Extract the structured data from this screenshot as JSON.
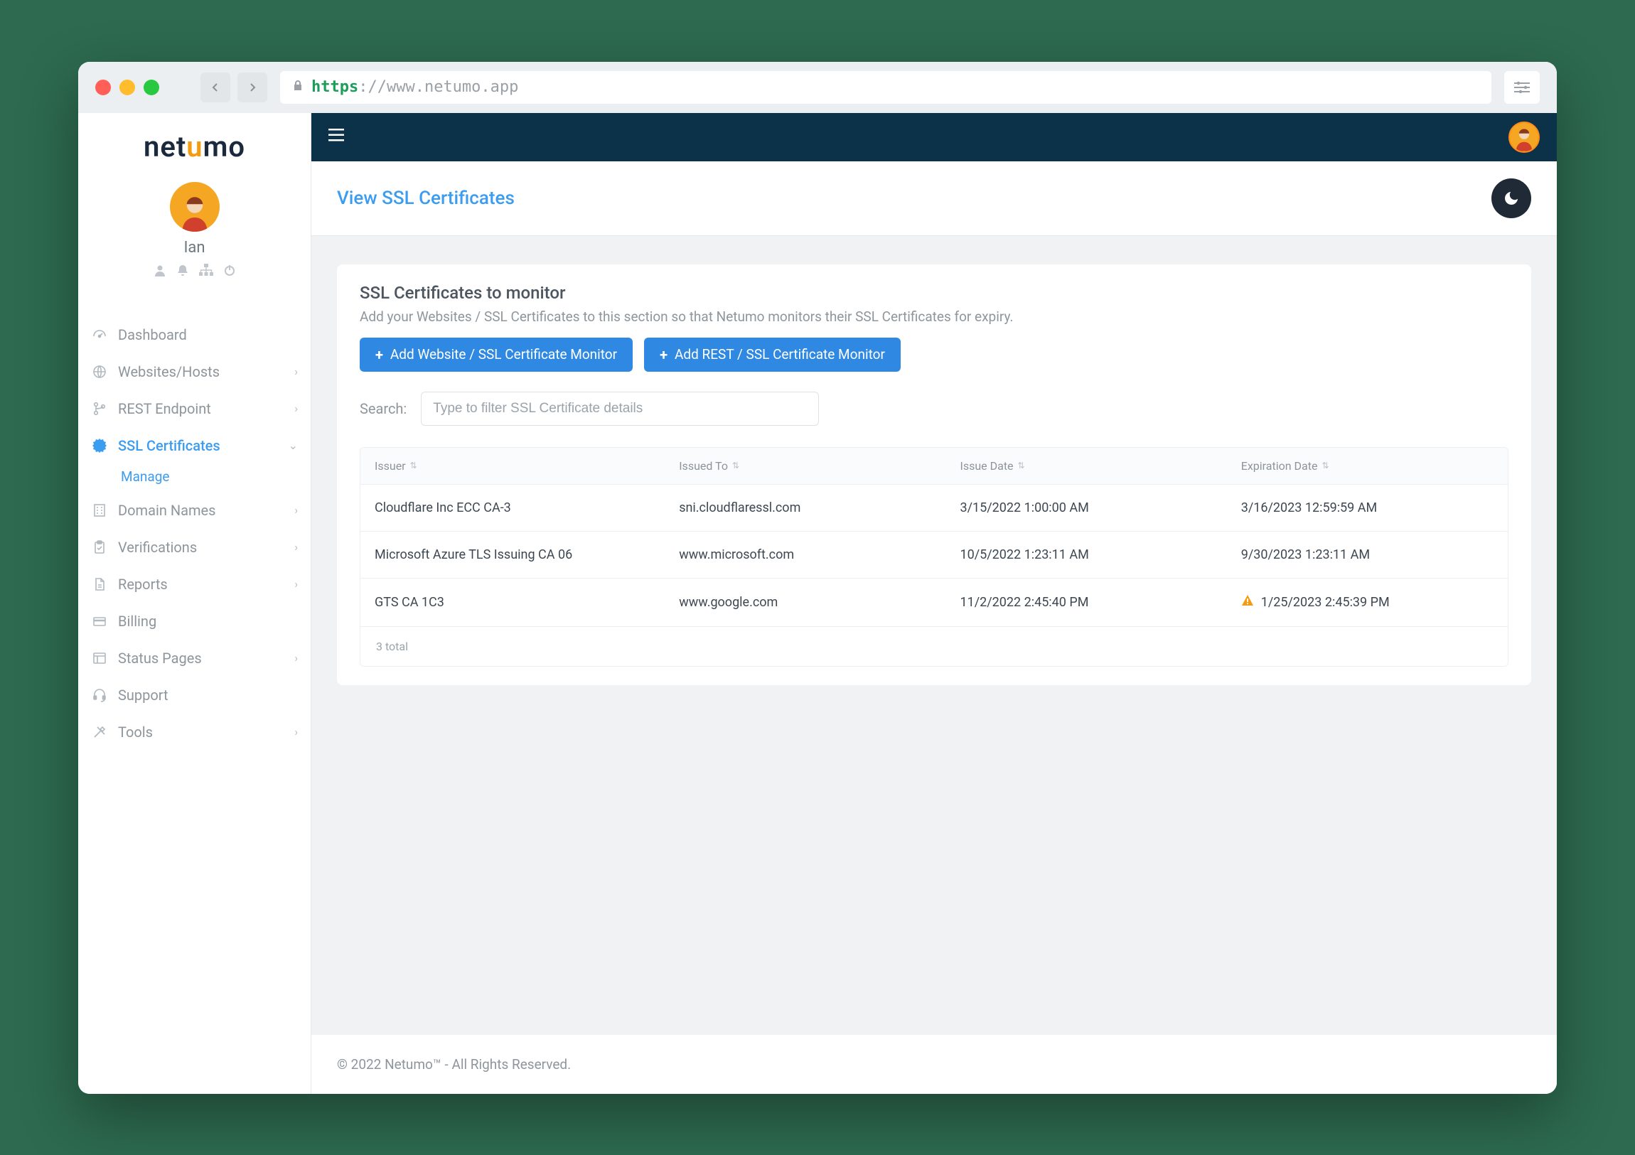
{
  "browser": {
    "protocol": "https",
    "url_rest": "://www.netumo.app"
  },
  "logo": {
    "pre": "net",
    "mid": "u",
    "post": "mo"
  },
  "user": {
    "name": "Ian"
  },
  "sidebar": {
    "items": [
      {
        "label": "Dashboard",
        "expandable": false
      },
      {
        "label": "Websites/Hosts",
        "expandable": true
      },
      {
        "label": "REST Endpoint",
        "expandable": true
      },
      {
        "label": "SSL Certificates",
        "expandable": true,
        "active": true,
        "sub": "Manage"
      },
      {
        "label": "Domain Names",
        "expandable": true
      },
      {
        "label": "Verifications",
        "expandable": true
      },
      {
        "label": "Reports",
        "expandable": true
      },
      {
        "label": "Billing",
        "expandable": false
      },
      {
        "label": "Status Pages",
        "expandable": true
      },
      {
        "label": "Support",
        "expandable": false
      },
      {
        "label": "Tools",
        "expandable": true
      }
    ]
  },
  "page": {
    "title": "View SSL Certificates",
    "card_title": "SSL Certificates to monitor",
    "card_subtitle": "Add your Websites / SSL Certificates to this section so that Netumo monitors their SSL Certificates for expiry.",
    "btn_add_website": "Add Website / SSL Certificate Monitor",
    "btn_add_rest": "Add REST / SSL Certificate Monitor",
    "search_label": "Search:",
    "search_placeholder": "Type to filter SSL Certificate details"
  },
  "table": {
    "columns": [
      "Issuer",
      "Issued To",
      "Issue Date",
      "Expiration Date"
    ],
    "rows": [
      {
        "issuer": "Cloudflare Inc ECC CA-3",
        "issued_to": "sni.cloudflaressl.com",
        "issue_date": "3/15/2022 1:00:00 AM",
        "expiration": "3/16/2023 12:59:59 AM",
        "warn": false
      },
      {
        "issuer": "Microsoft Azure TLS Issuing CA 06",
        "issued_to": "www.microsoft.com",
        "issue_date": "10/5/2022 1:23:11 AM",
        "expiration": "9/30/2023 1:23:11 AM",
        "warn": false
      },
      {
        "issuer": "GTS CA 1C3",
        "issued_to": "www.google.com",
        "issue_date": "11/2/2022 2:45:40 PM",
        "expiration": "1/25/2023 2:45:39 PM",
        "warn": true
      }
    ],
    "total_text": "3 total"
  },
  "footer": "© 2022 Netumo™ - All Rights Reserved."
}
